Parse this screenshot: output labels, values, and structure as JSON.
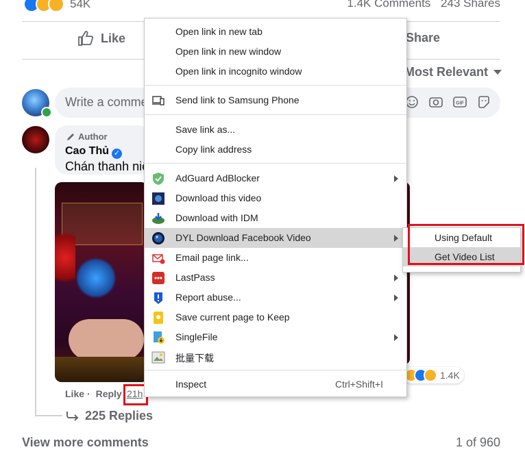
{
  "post_stats": {
    "reaction_count": "54K",
    "comments": "1.4K Comments",
    "shares": "243 Shares"
  },
  "actions": {
    "like": "Like",
    "share": "Share"
  },
  "sort": {
    "label": "Most Relevant"
  },
  "composer": {
    "placeholder": "Write a comment..."
  },
  "comment": {
    "author_badge": "Author",
    "author_name": "Cao Thủ",
    "text": "Chán thanh niên",
    "like_link": "Like",
    "reply_link": "Reply",
    "time": "21h",
    "reaction_count": "1.4K",
    "replies": "225 Replies"
  },
  "footer": {
    "view_more": "View more comments",
    "pager": "1 of 960"
  },
  "context_menu": {
    "items": [
      {
        "label": "Open link in new tab"
      },
      {
        "label": "Open link in new window"
      },
      {
        "label": "Open link in incognito window"
      },
      {
        "label": "Send link to Samsung Phone",
        "icon": "devices-icon"
      },
      {
        "label": "Save link as..."
      },
      {
        "label": "Copy link address"
      },
      {
        "label": "AdGuard AdBlocker",
        "icon": "adguard-shield-icon",
        "submenu": true
      },
      {
        "label": "Download this video",
        "icon": "download-video-icon"
      },
      {
        "label": "Download with IDM",
        "icon": "idm-icon"
      },
      {
        "label": "DYL Download Facebook Video",
        "icon": "dyl-globe-icon",
        "submenu": true,
        "highlighted": true
      },
      {
        "label": "Email page link...",
        "icon": "email-icon"
      },
      {
        "label": "LastPass",
        "icon": "lastpass-icon",
        "submenu": true
      },
      {
        "label": "Report abuse...",
        "icon": "report-icon",
        "submenu": true
      },
      {
        "label": "Save current page to Keep",
        "icon": "keep-icon"
      },
      {
        "label": "SingleFile",
        "icon": "singlefile-icon",
        "submenu": true
      },
      {
        "label": "批量下载",
        "icon": "batch-download-icon"
      },
      {
        "label": "Inspect",
        "shortcut": "Ctrl+Shift+I"
      }
    ],
    "submenu": {
      "items": [
        {
          "label": "Using Default"
        },
        {
          "label": "Get Video List",
          "highlighted": true
        }
      ]
    }
  },
  "colors": {
    "facebook_blue": "#1877f2",
    "highlight_box": "#e0111b",
    "menu_hover": "#d6d6d6"
  }
}
